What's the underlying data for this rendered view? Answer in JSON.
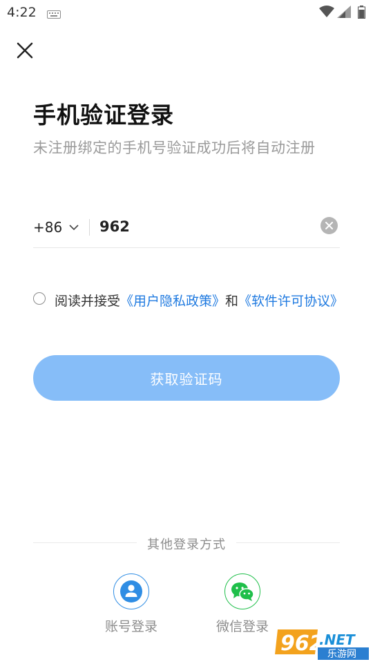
{
  "status_bar": {
    "time": "4:22"
  },
  "page": {
    "title": "手机验证登录",
    "subtitle": "未注册绑定的手机号验证成功后将自动注册"
  },
  "phone": {
    "country_code": "+86",
    "value": "962"
  },
  "agreement": {
    "prefix": "阅读并接受",
    "privacy_link": "《用户隐私政策》",
    "conjunction": "和",
    "license_link": "《软件许可协议》"
  },
  "buttons": {
    "get_code": "获取验证码"
  },
  "other_login": {
    "label": "其他登录方式",
    "account": "账号登录",
    "wechat": "微信登录"
  },
  "watermark": {
    "brand": "962",
    "suffix": ".NET",
    "tagline": "乐游网"
  },
  "colors": {
    "accent": "#1f7ae0",
    "button_disabled": "#86bdf8",
    "wechat_green": "#1fbf4a"
  },
  "icons": [
    "keyboard-icon",
    "wifi-icon",
    "signal-icon",
    "battery-icon",
    "close-icon",
    "chevron-down-icon",
    "clear-icon",
    "user-icon",
    "wechat-icon"
  ]
}
